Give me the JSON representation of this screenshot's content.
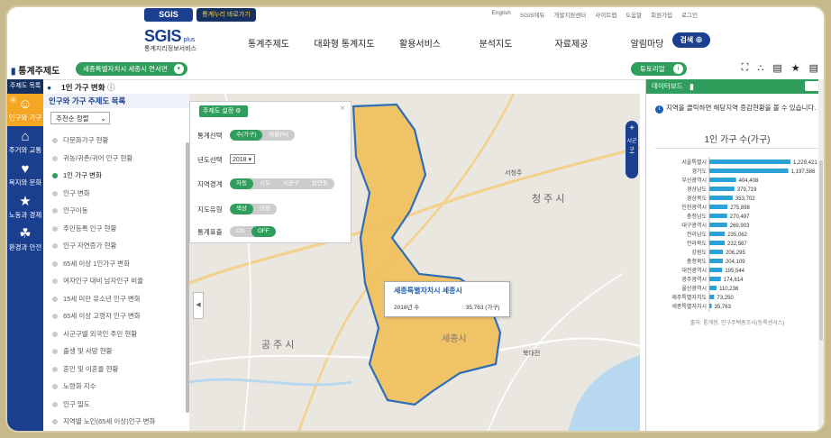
{
  "topbar": {
    "brand": "SGIS",
    "brand_plus": "plus",
    "shortcut": "바로가기",
    "shortcut_prefix": "통계누리",
    "links": [
      "English",
      "SGIS에듀",
      "개발지원센터",
      "사이트맵",
      "도움말",
      "회원가입",
      "로그인"
    ]
  },
  "header": {
    "logo_title": "SGIS",
    "logo_plus": "plus",
    "logo_sub": "통계지리정보서비스",
    "nav": [
      "통계주제도",
      "대화형 통계지도",
      "활용서비스",
      "분석지도",
      "자료제공",
      "알림마당"
    ],
    "search": "검색"
  },
  "subbar": {
    "title": "통계주제도",
    "region": "세종특별자치시 세종시 연서면",
    "tutorial": "튜토리얼"
  },
  "rail": {
    "head": "주제도 목록",
    "items": [
      {
        "label": "인구와 가구",
        "icon": "people-icon",
        "active": true
      },
      {
        "label": "주거와 교통",
        "icon": "house-icon",
        "active": false
      },
      {
        "label": "복지와 문화",
        "icon": "heart-icon",
        "active": false
      },
      {
        "label": "노동과 경제",
        "icon": "handshake-icon",
        "active": false
      },
      {
        "label": "환경과 안전",
        "icon": "leaf-icon",
        "active": false
      }
    ]
  },
  "list_panel": {
    "title": "인구와 가구 주제도 목록",
    "sort": "추천순 정렬",
    "items": [
      "다문화가구 현황",
      "귀농/귀촌/귀어 인구 현황",
      "1인 가구 변화",
      "인구 변화",
      "인구이동",
      "주민등록 인구 현황",
      "인구 자연증가 현황",
      "65세 이상 1인가구 변화",
      "여자인구 대비 남자인구 비율",
      "15세 미만 유소년 인구 변화",
      "65세 이상 고령자 인구 변화",
      "시군구별 외국인 주민 현황",
      "출생 및 사망 현황",
      "혼인 및 이혼율 현황",
      "노령화 지수",
      "인구 밀도",
      "지역별 노인(65세 이상)인구 변화"
    ],
    "selected_index": 2
  },
  "map": {
    "title": "1인 가구 변화",
    "zoom_label": "시군구",
    "settings": {
      "head": "주제도 설정",
      "stat_label": "통계선택",
      "stat_options": [
        "수(가구)",
        "비율(%)"
      ],
      "year_label": "년도선택",
      "year": "2018",
      "region_label": "지역경계",
      "region_options": [
        "자동",
        "시도",
        "시군구",
        "읍면동"
      ],
      "map_type_label": "지도유형",
      "map_type_options": [
        "색상",
        "버블"
      ],
      "stat_display_label": "통계표출",
      "stat_display_options": [
        "ON",
        "OFF"
      ]
    },
    "popup": {
      "title": "세종특별자치시 세종시",
      "row_label": "2018년 수",
      "row_value": ": 35,763 (가구)"
    },
    "place_labels": [
      "청 주 시",
      "공 주 시",
      "세종시",
      "서청주",
      "북대전"
    ],
    "colors": {
      "region_fill": "#f0c05a",
      "region_border": "#1a5fb4"
    }
  },
  "board": {
    "head": "데이터보드",
    "note": "지역을 클릭하면 해당지역 증감현황을 볼 수 있습니다.",
    "source": "출처: 통계청, 인구주택총조사(등록센서스)",
    "chart_data": {
      "type": "bar",
      "title": "1인 가구 수(가구)",
      "categories": [
        "서울특별시",
        "경기도",
        "부산광역시",
        "경상남도",
        "경상북도",
        "인천광역시",
        "충청남도",
        "대구광역시",
        "전라남도",
        "전라북도",
        "강원도",
        "충청북도",
        "대전광역시",
        "광주광역시",
        "울산광역시",
        "제주특별자치도",
        "세종특별자치시"
      ],
      "values": [
        1229421,
        1197586,
        404408,
        379719,
        353702,
        275898,
        270497,
        269903,
        235062,
        232587,
        206295,
        204109,
        195544,
        174614,
        110236,
        73250,
        35763
      ],
      "value_labels": [
        "1,229,421",
        "1,197,586",
        "404,408",
        "379,719",
        "353,702",
        "275,898",
        "270,497",
        "269,903",
        "235,062",
        "232,587",
        "206,295",
        "204,109",
        "195,544",
        "174,614",
        "110,236",
        "73,250",
        "35,763"
      ],
      "bar_color": "#2ba3d6"
    }
  }
}
